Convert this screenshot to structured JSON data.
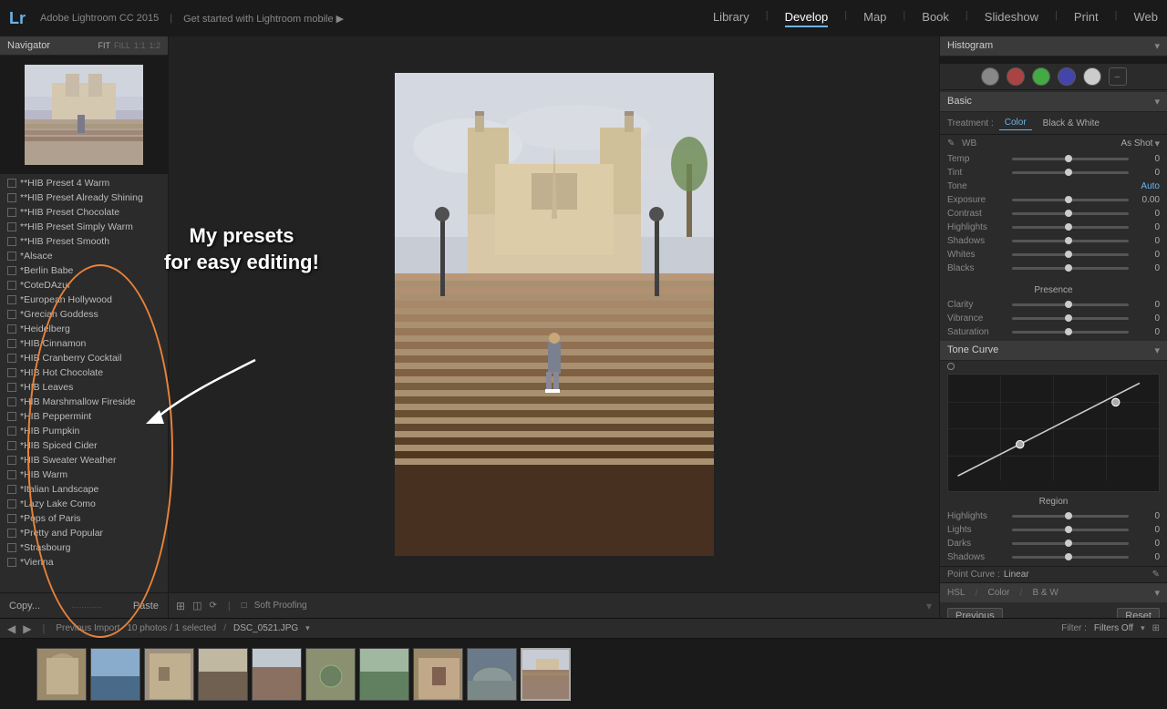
{
  "app": {
    "logo": "Lr",
    "title": "Adobe Lightroom CC 2015",
    "promo": "Get started with Lightroom mobile ▶"
  },
  "top_nav": {
    "items": [
      {
        "label": "Library",
        "active": false
      },
      {
        "label": "Develop",
        "active": true
      },
      {
        "label": "Map",
        "active": false
      },
      {
        "label": "Book",
        "active": false
      },
      {
        "label": "Slideshow",
        "active": false
      },
      {
        "label": "Print",
        "active": false
      },
      {
        "label": "Web",
        "active": false
      }
    ]
  },
  "left_panel": {
    "navigator_title": "Navigator",
    "fit_options": [
      "FIT",
      "FILL",
      "1:1",
      "1:2"
    ],
    "presets": [
      "**HIB Preset 4 Warm",
      "**HIB Preset Already Shining",
      "**HIB Preset Chocolate",
      "**HIB Preset Simply Warm",
      "**HIB Preset Smooth",
      "*Alsace",
      "*Berlin Babe",
      "*CoteDAzur",
      "*European Hollywood",
      "*Grecian Goddess",
      "*Heidelberg",
      "*HIB Cinnamon",
      "*HIB Cranberry Cocktail",
      "*HIB Hot Chocolate",
      "*HIB Leaves",
      "*HIB Marshmallow Fireside",
      "*HIB Peppermint",
      "*HIB Pumpkin",
      "*HIB Spiced Cider",
      "*HIB Sweater Weather",
      "*HIB Warm",
      "*Italian Landscape",
      "*Lazy Lake Como",
      "*Pops of Paris",
      "*Pretty and Popular",
      "*Strasbourg",
      "*Vienna"
    ],
    "copy_label": "Copy...",
    "paste_label": "Paste"
  },
  "annotation": {
    "text": "My presets\nfor easy editing!"
  },
  "right_panel": {
    "histogram_title": "Histogram",
    "basic_title": "Basic",
    "basic_arrow": "▾",
    "treatment_label": "Treatment :",
    "color_btn": "Color",
    "bw_btn": "Black & White",
    "wb_label": "WB",
    "wb_value": "As Shot",
    "temp_label": "Temp",
    "temp_value": "0",
    "tint_label": "Tint",
    "tint_value": "0",
    "tone_label": "Tone",
    "tone_auto": "Auto",
    "exposure_label": "Exposure",
    "exposure_value": "0.00",
    "contrast_label": "Contrast",
    "contrast_value": "0",
    "highlights_label": "Highlights",
    "highlights_value": "0",
    "shadows_label": "Shadows",
    "shadows_value": "0",
    "whites_label": "Whites",
    "whites_value": "0",
    "blacks_label": "Blacks",
    "blacks_value": "0",
    "presence_label": "Presence",
    "clarity_label": "Clarity",
    "clarity_value": "0",
    "vibrance_label": "Vibrance",
    "vibrance_value": "0",
    "saturation_label": "Saturation",
    "saturation_value": "0",
    "tone_curve_title": "Tone Curve",
    "tone_curve_arrow": "▾",
    "region_label": "Region",
    "highlights_r_label": "Highlights",
    "highlights_r_value": "0",
    "lights_label": "Lights",
    "lights_value": "0",
    "darks_label": "Darks",
    "darks_value": "0",
    "shadows_r_label": "Shadows",
    "shadows_r_value": "0",
    "point_curve_label": "Point Curve :",
    "point_curve_value": "Linear",
    "hsl_label": "HSL",
    "color_label2": "Color",
    "bw_label2": "B & W",
    "previous_btn": "Previous",
    "reset_btn": "Reset"
  },
  "image_toolbar": {
    "soft_proofing_label": "Soft Proofing"
  },
  "bottom_strip": {
    "mode_label": "Previous Import",
    "count_label": "10 photos / 1 selected",
    "filename": "DSC_0521.JPG",
    "filter_label": "Filter :",
    "filter_value": "Filters Off",
    "thumbnails": [
      {
        "id": 1,
        "bg": "#7a8a6a"
      },
      {
        "id": 2,
        "bg": "#5a7a9a"
      },
      {
        "id": 3,
        "bg": "#a09080"
      },
      {
        "id": 4,
        "bg": "#8a6a5a"
      },
      {
        "id": 5,
        "bg": "#9a8a7a"
      },
      {
        "id": 6,
        "bg": "#8a9070"
      },
      {
        "id": 7,
        "bg": "#7a8a7a"
      },
      {
        "id": 8,
        "bg": "#9a8868"
      },
      {
        "id": 9,
        "bg": "#6a7a8a"
      },
      {
        "id": 10,
        "bg": "#aaa090",
        "selected": true
      }
    ]
  }
}
